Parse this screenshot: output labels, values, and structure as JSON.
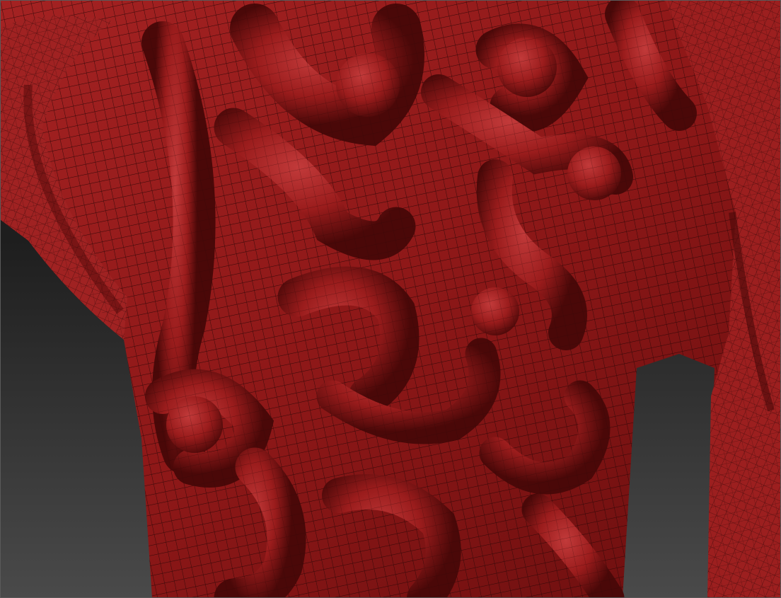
{
  "viewport": {
    "background_top": "#141414",
    "background_bottom": "#4a4a4a"
  },
  "model": {
    "material_base": "#8e1818",
    "material_highlight": "#c23a3a",
    "material_shadow": "#4a0808",
    "wireframe_color": "#2a0606"
  }
}
